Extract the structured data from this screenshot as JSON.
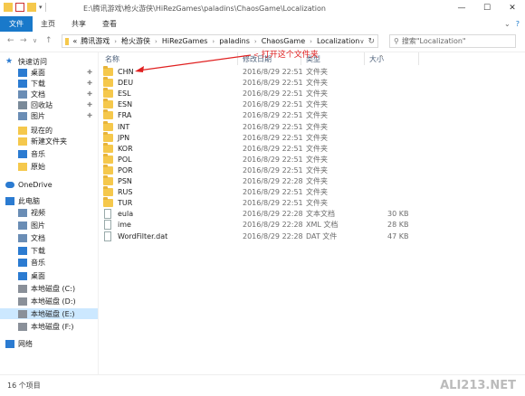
{
  "window": {
    "title": "E:\\腾讯游戏\\枪火游侠\\HiRezGames\\paladins\\ChaosGame\\Localization"
  },
  "ribbon": {
    "tabs": [
      "文件",
      "主页",
      "共享",
      "查看"
    ]
  },
  "address": {
    "prefix": "«",
    "crumbs": [
      "腾讯游戏",
      "枪火游侠",
      "HiRezGames",
      "paladins",
      "ChaosGame",
      "Localization"
    ]
  },
  "search": {
    "placeholder": "搜索\"Localization\""
  },
  "sidebar": {
    "items": [
      {
        "label": "快速访问",
        "icon": "star-icon",
        "pinned": false,
        "selected": false
      },
      {
        "label": "桌面",
        "icon": "desktop-icon",
        "pinned": true,
        "selected": false
      },
      {
        "label": "下载",
        "icon": "download-icon",
        "pinned": true,
        "selected": false
      },
      {
        "label": "文档",
        "icon": "document-icon",
        "pinned": true,
        "selected": false
      },
      {
        "label": "回收站",
        "icon": "recycle-bin-icon",
        "pinned": true,
        "selected": false
      },
      {
        "label": "图片",
        "icon": "pictures-icon",
        "pinned": true,
        "selected": false
      },
      {
        "label": "现在的",
        "icon": "folder-icon",
        "pinned": false,
        "selected": false
      },
      {
        "label": "新建文件夹",
        "icon": "folder-icon",
        "pinned": false,
        "selected": false
      },
      {
        "label": "音乐",
        "icon": "music-icon",
        "pinned": false,
        "selected": false
      },
      {
        "label": "原始",
        "icon": "folder-icon",
        "pinned": false,
        "selected": false
      },
      {
        "label": "OneDrive",
        "icon": "cloud-icon",
        "pinned": false,
        "selected": false
      },
      {
        "label": "此电脑",
        "icon": "computer-icon",
        "pinned": false,
        "selected": false
      },
      {
        "label": "视频",
        "icon": "video-icon",
        "pinned": false,
        "selected": false
      },
      {
        "label": "图片",
        "icon": "pictures-icon",
        "pinned": false,
        "selected": false
      },
      {
        "label": "文档",
        "icon": "document-icon",
        "pinned": false,
        "selected": false
      },
      {
        "label": "下载",
        "icon": "download-icon",
        "pinned": false,
        "selected": false
      },
      {
        "label": "音乐",
        "icon": "music-icon",
        "pinned": false,
        "selected": false
      },
      {
        "label": "桌面",
        "icon": "desktop-icon",
        "pinned": false,
        "selected": false
      },
      {
        "label": "本地磁盘 (C:)",
        "icon": "drive-icon",
        "pinned": false,
        "selected": false
      },
      {
        "label": "本地磁盘 (D:)",
        "icon": "drive-icon",
        "pinned": false,
        "selected": false
      },
      {
        "label": "本地磁盘 (E:)",
        "icon": "drive-icon",
        "pinned": false,
        "selected": true
      },
      {
        "label": "本地磁盘 (F:)",
        "icon": "drive-icon",
        "pinned": false,
        "selected": false
      },
      {
        "label": "网络",
        "icon": "network-icon",
        "pinned": false,
        "selected": false
      }
    ]
  },
  "columns": {
    "name": "名称",
    "date": "修改日期",
    "type": "类型",
    "size": "大小"
  },
  "files": [
    {
      "name": "CHN",
      "date": "2016/8/29 22:51",
      "type": "文件夹",
      "size": "",
      "kind": "folder"
    },
    {
      "name": "DEU",
      "date": "2016/8/29 22:51",
      "type": "文件夹",
      "size": "",
      "kind": "folder"
    },
    {
      "name": "ESL",
      "date": "2016/8/29 22:51",
      "type": "文件夹",
      "size": "",
      "kind": "folder"
    },
    {
      "name": "ESN",
      "date": "2016/8/29 22:51",
      "type": "文件夹",
      "size": "",
      "kind": "folder"
    },
    {
      "name": "FRA",
      "date": "2016/8/29 22:51",
      "type": "文件夹",
      "size": "",
      "kind": "folder"
    },
    {
      "name": "INT",
      "date": "2016/8/29 22:51",
      "type": "文件夹",
      "size": "",
      "kind": "folder"
    },
    {
      "name": "JPN",
      "date": "2016/8/29 22:51",
      "type": "文件夹",
      "size": "",
      "kind": "folder"
    },
    {
      "name": "KOR",
      "date": "2016/8/29 22:51",
      "type": "文件夹",
      "size": "",
      "kind": "folder"
    },
    {
      "name": "POL",
      "date": "2016/8/29 22:51",
      "type": "文件夹",
      "size": "",
      "kind": "folder"
    },
    {
      "name": "POR",
      "date": "2016/8/29 22:51",
      "type": "文件夹",
      "size": "",
      "kind": "folder"
    },
    {
      "name": "PSN",
      "date": "2016/8/29 22:28",
      "type": "文件夹",
      "size": "",
      "kind": "folder"
    },
    {
      "name": "RUS",
      "date": "2016/8/29 22:51",
      "type": "文件夹",
      "size": "",
      "kind": "folder"
    },
    {
      "name": "TUR",
      "date": "2016/8/29 22:51",
      "type": "文件夹",
      "size": "",
      "kind": "folder"
    },
    {
      "name": "eula",
      "date": "2016/8/29 22:28",
      "type": "文本文档",
      "size": "30 KB",
      "kind": "file"
    },
    {
      "name": "ime",
      "date": "2016/8/29 22:28",
      "type": "XML 文档",
      "size": "28 KB",
      "kind": "file"
    },
    {
      "name": "WordFilter.dat",
      "date": "2016/8/29 22:28",
      "type": "DAT 文件",
      "size": "47 KB",
      "kind": "file"
    }
  ],
  "annotation": {
    "text": "打开这个文件夹",
    "color": "#e02020"
  },
  "status": {
    "count": "16 个项目"
  },
  "watermark": "ALI213.NET",
  "colors": {
    "file_tab": "#1979ca",
    "selected": "#cce8ff",
    "folder": "#f5c84c"
  }
}
